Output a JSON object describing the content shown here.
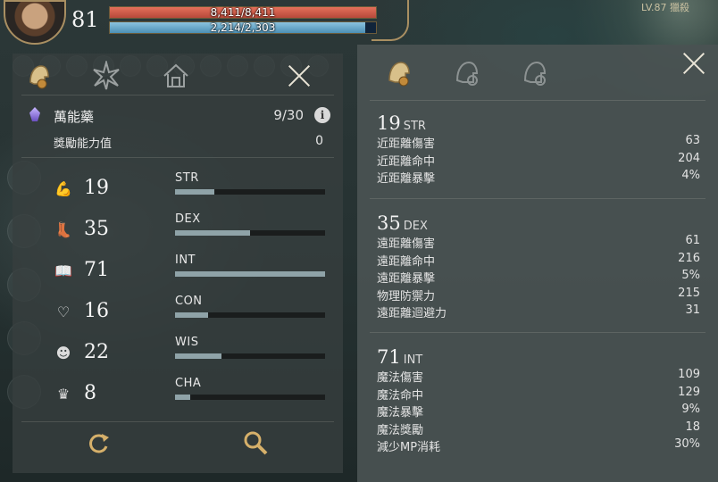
{
  "hud": {
    "level": "81",
    "hp_text": "8,411/8,411",
    "mp_text": "2,214/2,303",
    "hp_fraction": 1.0,
    "mp_fraction": 0.961,
    "corner_level": "LV.87 獵殺"
  },
  "left_panel": {
    "potion": {
      "name": "萬能藥",
      "count": "9/30",
      "info": "i"
    },
    "bonus": {
      "label": "獎勵能力值",
      "value": "0"
    },
    "stats": [
      {
        "icon": "arm-icon",
        "value": "19",
        "abbr": "STR",
        "fill": 0.26
      },
      {
        "icon": "boot-icon",
        "value": "35",
        "abbr": "DEX",
        "fill": 0.5
      },
      {
        "icon": "book-icon",
        "value": "71",
        "abbr": "INT",
        "fill": 1.0
      },
      {
        "icon": "heart-icon",
        "value": "16",
        "abbr": "CON",
        "fill": 0.22
      },
      {
        "icon": "mind-icon",
        "value": "22",
        "abbr": "WIS",
        "fill": 0.31
      },
      {
        "icon": "crown-icon",
        "value": "8",
        "abbr": "CHA",
        "fill": 0.1
      }
    ]
  },
  "right_panel": {
    "sections": [
      {
        "value": "19",
        "abbr": "STR",
        "rows": [
          {
            "label": "近距離傷害",
            "value": "63"
          },
          {
            "label": "近距離命中",
            "value": "204"
          },
          {
            "label": "近距離暴擊",
            "value": "4%"
          }
        ]
      },
      {
        "value": "35",
        "abbr": "DEX",
        "rows": [
          {
            "label": "遠距離傷害",
            "value": "61"
          },
          {
            "label": "遠距離命中",
            "value": "216"
          },
          {
            "label": "遠距離暴擊",
            "value": "5%"
          },
          {
            "label": "物理防禦力",
            "value": "215"
          },
          {
            "label": "遠距離迴避力",
            "value": "31"
          }
        ]
      },
      {
        "value": "71",
        "abbr": "INT",
        "rows": [
          {
            "label": "魔法傷害",
            "value": "109"
          },
          {
            "label": "魔法命中",
            "value": "129"
          },
          {
            "label": "魔法暴擊",
            "value": "9%"
          },
          {
            "label": "魔法獎勵",
            "value": "18"
          },
          {
            "label": "減少MP消耗",
            "value": "30%"
          }
        ]
      }
    ]
  },
  "colors": {
    "hp": "#d35f4b",
    "mp": "#6aaed0",
    "panel": "#3e4545",
    "accent": "#a98f62"
  }
}
